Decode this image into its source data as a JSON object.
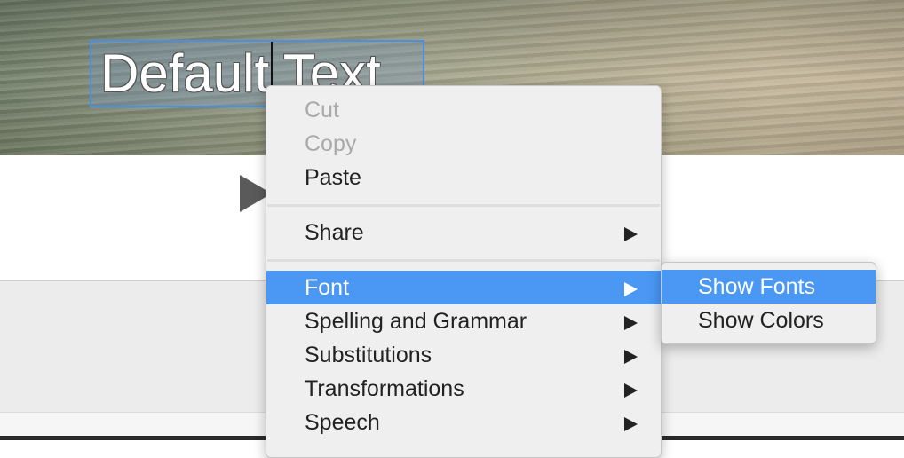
{
  "canvas": {
    "text_box": {
      "text": "Default Text"
    }
  },
  "context_menu": {
    "items": [
      {
        "label": "Cut",
        "enabled": false,
        "has_submenu": false
      },
      {
        "label": "Copy",
        "enabled": false,
        "has_submenu": false
      },
      {
        "label": "Paste",
        "enabled": true,
        "has_submenu": false
      },
      {
        "label": "Share",
        "enabled": true,
        "has_submenu": true
      },
      {
        "label": "Font",
        "enabled": true,
        "has_submenu": true,
        "highlighted": true
      },
      {
        "label": "Spelling and Grammar",
        "enabled": true,
        "has_submenu": true
      },
      {
        "label": "Substitutions",
        "enabled": true,
        "has_submenu": true
      },
      {
        "label": "Transformations",
        "enabled": true,
        "has_submenu": true
      },
      {
        "label": "Speech",
        "enabled": true,
        "has_submenu": true
      }
    ]
  },
  "font_submenu": {
    "items": [
      {
        "label": "Show Fonts",
        "highlighted": true
      },
      {
        "label": "Show Colors",
        "highlighted": false
      }
    ]
  },
  "colors": {
    "highlight": "#4a98f4",
    "selection_border": "#4c8fe0",
    "menu_background": "#efefef",
    "disabled_text": "#a9a9a9"
  },
  "icons": {
    "submenu_arrow": "triangle-right",
    "play": "play-triangle"
  }
}
